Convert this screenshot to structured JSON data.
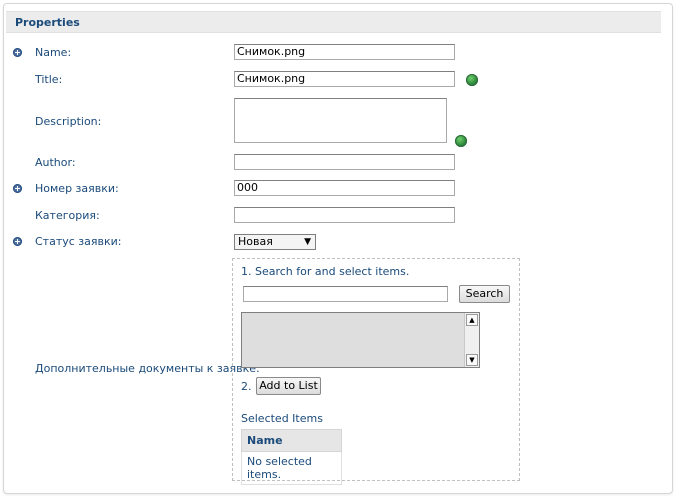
{
  "section": {
    "title": "Properties"
  },
  "fields": {
    "name": {
      "label": "Name:",
      "value": "Снимок.png"
    },
    "title": {
      "label": "Title:",
      "value": "Снимок.png"
    },
    "description": {
      "label": "Description:",
      "value": ""
    },
    "author": {
      "label": "Author:",
      "value": ""
    },
    "request_number": {
      "label": "Номер заявки:",
      "value": "000"
    },
    "category": {
      "label": "Категория:",
      "value": ""
    },
    "status": {
      "label": "Статус заявки:",
      "value": "Новая"
    },
    "docs": {
      "label": "Дополнительные документы к заявке:"
    }
  },
  "picker": {
    "step1": "1. Search for and select items.",
    "search_value": "",
    "search_button": "Search",
    "step2": "2.",
    "add_button": "Add to List",
    "selected_title": "Selected Items",
    "column_name": "Name",
    "empty_text": "No selected items."
  },
  "colors": {
    "label": "#1a4a7a",
    "header_bg": "#ececec"
  },
  "icons": {
    "required": "required-marker-icon",
    "translate": "globe-icon"
  }
}
